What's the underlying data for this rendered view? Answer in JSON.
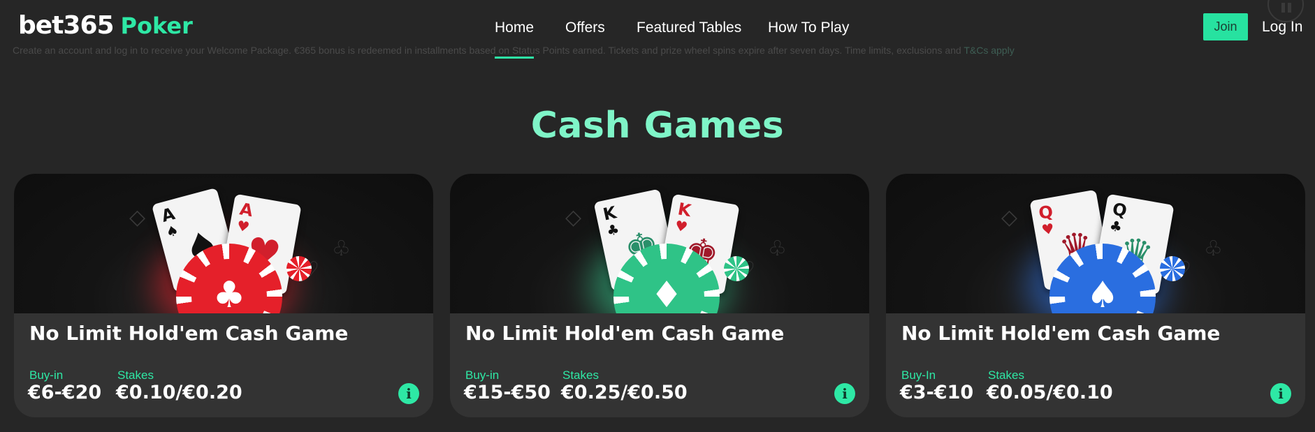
{
  "header": {
    "logo_brand": "bet365",
    "logo_product": "Poker",
    "banner_text_start": "Create an account and log in to receive your Welcome Package. €365 bonus is redeemed in installments based on Status Points earned. Tickets and prize wheel spins expire after seven days. Time limits, exclusions and ",
    "banner_link": "T&Cs apply",
    "nav": [
      "Home",
      "Offers",
      "Featured Tables",
      "How To Play"
    ],
    "active_nav": "Home",
    "join_label": "Join",
    "login_label": "Log In"
  },
  "section_title": "Cash Games",
  "cards": [
    {
      "title": "No Limit Hold'em Cash Game",
      "buyin_label": "Buy-in",
      "buyin_value": "€6-€20",
      "stakes_label": "Stakes",
      "stakes_value": "€0.10/€0.20",
      "hand": [
        "A",
        "A"
      ],
      "chip_color": "#e5202a",
      "chip_suit": "♣",
      "suits": [
        "♠",
        "♥"
      ]
    },
    {
      "title": "No Limit Hold'em Cash Game",
      "buyin_label": "Buy-in",
      "buyin_value": "€15-€50",
      "stakes_label": "Stakes",
      "stakes_value": "€0.25/€0.50",
      "hand": [
        "K",
        "K"
      ],
      "chip_color": "#2fc387",
      "chip_suit": "♦",
      "suits": [
        "♣",
        "♥"
      ]
    },
    {
      "title": "No Limit Hold'em Cash Game",
      "buyin_label": "Buy-In",
      "buyin_value": "€3-€10",
      "stakes_label": "Stakes",
      "stakes_value": "€0.05/€0.10",
      "hand": [
        "Q",
        "Q"
      ],
      "chip_color": "#2a6ee0",
      "chip_suit": "♠",
      "suits": [
        "♥",
        "♣"
      ]
    }
  ],
  "colors": {
    "accent": "#2ee8a5",
    "title": "#7ff5c8",
    "background": "#262626",
    "card_bg": "#333333"
  },
  "icons": [
    "info-icon",
    "pause-icon",
    "club-icon",
    "diamond-icon",
    "spade-icon"
  ]
}
